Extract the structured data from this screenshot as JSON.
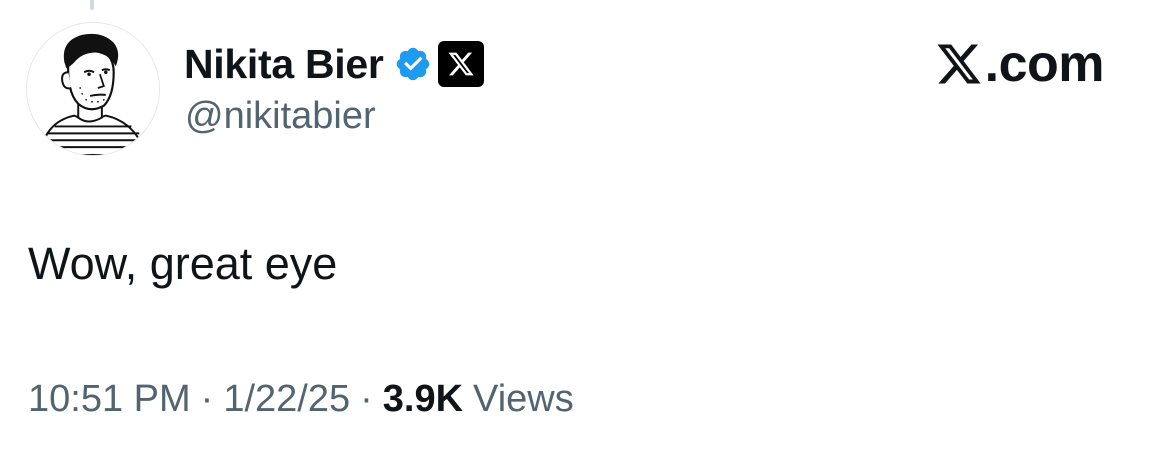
{
  "author": {
    "display_name": "Nikita Bier",
    "handle": "@nikitabier",
    "verified_icon": "verified-badge-icon",
    "affiliate_icon": "x-logo-icon",
    "verified_color": "#1d9bf0"
  },
  "brand": {
    "text": ".com",
    "icon": "x-logo-icon"
  },
  "tweet": {
    "text": "Wow, great eye"
  },
  "meta": {
    "time": "10:51 PM",
    "separator": "·",
    "date": "1/22/25",
    "views_count": "3.9K",
    "views_label": "Views"
  },
  "colors": {
    "text_primary": "#0f1419",
    "text_secondary": "#536471",
    "background": "#ffffff"
  }
}
